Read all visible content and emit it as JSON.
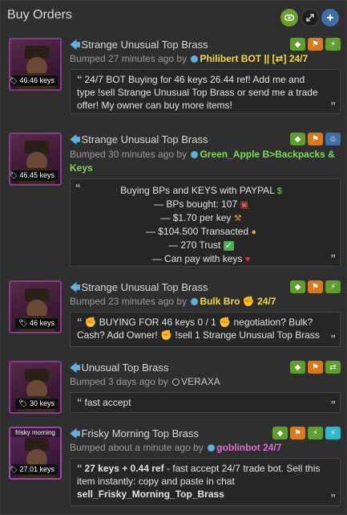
{
  "header": {
    "title": "Buy Orders"
  },
  "items": [
    {
      "title": "Strange Unusual Top Brass",
      "price": "46.46 keys",
      "bumped": "Bumped 27 minutes ago by",
      "user": "Philibert BOT || [⇄] 24/7",
      "comment": "24/7 BOT Buying for 46 keys 26.44 ref! Add me and type !sell Strange Unusual Top Brass or send me a trade offer! My owner can buy more items!"
    },
    {
      "title": "Strange Unusual Top Brass",
      "price": "46.45 keys",
      "bumped": "Bumped 30 minutes ago by",
      "user": "Green_Apple B>Backpacks & Keys",
      "comment_lines": [
        "Buying BPs and KEYS with PAYPAL",
        "— BPs bought: 107",
        "— $1.70 per key",
        "— $104.500 Transacted",
        "— 270 Trust",
        "— Can pay with keys"
      ]
    },
    {
      "title": "Strange Unusual Top Brass",
      "price": "46 keys",
      "bumped": "Bumped 23 minutes ago by",
      "user": "Bulk Bro",
      "user_suffix": "24/7",
      "comment": "BUYING FOR 46 keys 0 / 1",
      "comment_b": "negotiation? Bulk? Cash? Add Owner!",
      "comment_c": "!sell 1 Strange Unusual Top Brass"
    },
    {
      "title": "Unusual Top Brass",
      "price": "30 keys",
      "bumped": "Bumped 3 days ago by",
      "user": "VERAXA",
      "comment": "fast accept"
    },
    {
      "title": "Frisky Morning Top Brass",
      "price": "27.01 keys",
      "thumb_label": "frisky morning",
      "bumped": "Bumped about a minute ago by",
      "user": "goblinbot 24/7",
      "comment_bold": "27 keys + 0.44 ref",
      "comment": " - fast accept 24/7 trade bot. Sell this item instantly: copy and paste in chat",
      "comment_cmd": "sell_Frisky_Morning_Top_Brass"
    }
  ],
  "colors": {
    "accent_green": "#5f9e2e",
    "accent_orange": "#d77a1f",
    "accent_blue": "#3f6fa8",
    "accent_cyan": "#2fb8c8"
  }
}
